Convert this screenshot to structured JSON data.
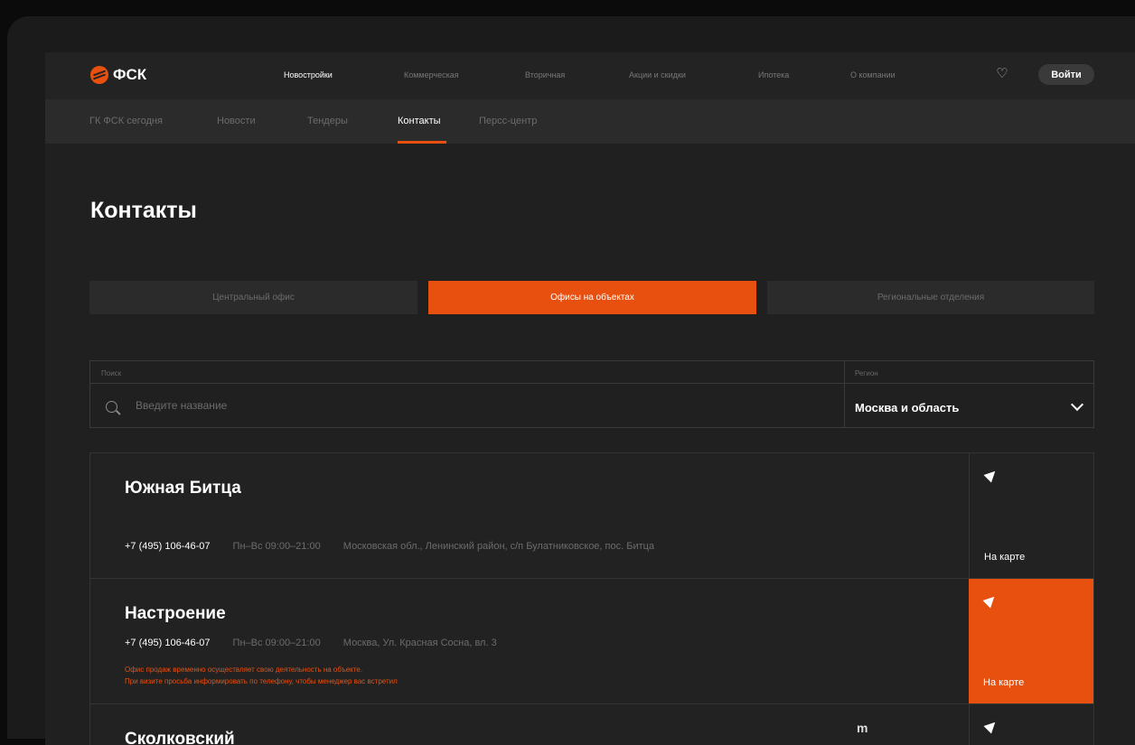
{
  "header": {
    "logo": "ФСК",
    "nav": [
      "Новостройки",
      "Коммерческая",
      "Вторичная",
      "Акции и скидки",
      "Ипотека",
      "О компании"
    ],
    "login": "Войти"
  },
  "subnav": [
    "ГК ФСК сегодня",
    "Новости",
    "Тендеры",
    "Контакты",
    "Персс-центр"
  ],
  "page_title": "Контакты",
  "tabs": [
    "Центральный офис",
    "Офисы на объектах",
    "Региональные отделения"
  ],
  "filter": {
    "search_label": "Поиск",
    "search_placeholder": "Введите название",
    "region_label": "Регион",
    "region_value": "Москва и область"
  },
  "offices": [
    {
      "name": "Южная Битца",
      "phone": "+7 (495) 106-46-07",
      "hours": "Пн–Вс  09:00–21:00",
      "address": "Московская обл., Ленинский район, с/п Булатниковское, пос. Битца",
      "map_label": "На карте"
    },
    {
      "name": "Настроение",
      "phone": "+7 (495) 106-46-07",
      "hours": "Пн–Вс  09:00–21:00",
      "address": "Москва, Ул. Красная Сосна, вл. 3",
      "notice_1": "Офис продаж временно осуществляет свою деятельность на объекте.",
      "notice_2": "При визите просьба информировать по телефону, чтобы менеджер вас встретил",
      "map_label": "На карте"
    },
    {
      "name": "Сколковский",
      "metro": "m"
    }
  ],
  "colors": {
    "accent": "#e8500f",
    "bg": "#202020"
  }
}
